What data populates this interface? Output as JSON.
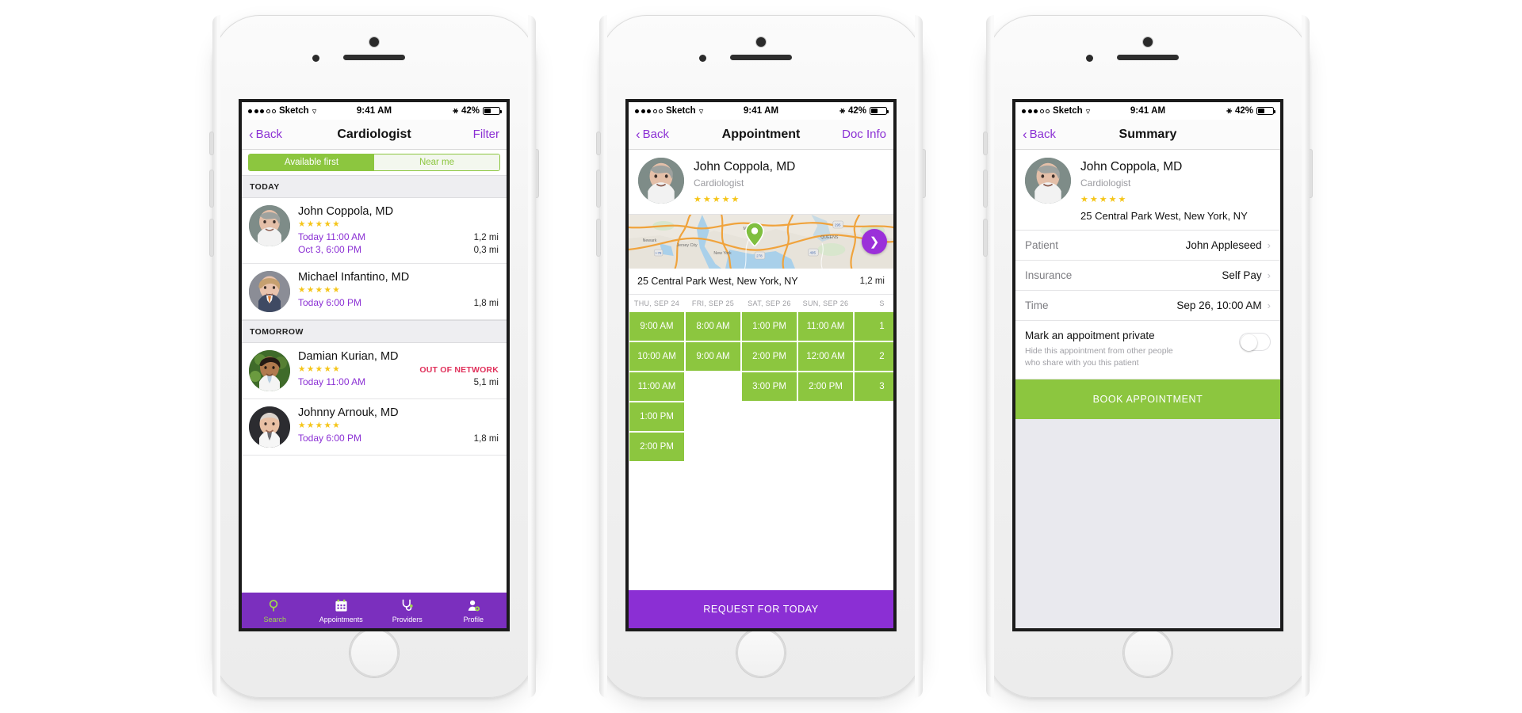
{
  "statusbar": {
    "carrier": "Sketch",
    "time": "9:41 AM",
    "battery": "42%",
    "wifi_icon": "wifi-icon",
    "bluetooth_icon": "bluetooth-icon"
  },
  "phone1": {
    "nav": {
      "back": "Back",
      "title": "Cardiologist",
      "right": "Filter"
    },
    "segmented": {
      "options": [
        "Available first",
        "Near me"
      ],
      "selected": "Available first"
    },
    "sections": [
      {
        "header": "TODAY",
        "doctors": [
          {
            "name": "John Coppola, MD",
            "stars": 5,
            "slots": [
              "Today 11:00 AM",
              "Oct 3, 6:00 PM"
            ],
            "distances": [
              "1,2 mi",
              "0,3 mi"
            ],
            "badge": ""
          },
          {
            "name": "Michael Infantino, MD",
            "stars": 5,
            "slots": [
              "Today 6:00 PM"
            ],
            "distances": [
              "1,8 mi"
            ],
            "badge": ""
          }
        ]
      },
      {
        "header": "TOMORROW",
        "doctors": [
          {
            "name": "Damian Kurian, MD",
            "stars": 5,
            "slots": [
              "Today 11:00 AM"
            ],
            "distances": [
              "5,1 mi"
            ],
            "badge": "OUT OF NETWORK"
          },
          {
            "name": "Johnny Arnouk, MD",
            "stars": 5,
            "slots": [
              "Today 6:00 PM"
            ],
            "distances": [
              "1,8 mi"
            ],
            "badge": ""
          }
        ]
      }
    ],
    "tabs": [
      {
        "label": "Search",
        "icon": "search-icon",
        "active": true
      },
      {
        "label": "Appointments",
        "icon": "calendar-icon",
        "active": false
      },
      {
        "label": "Providers",
        "icon": "stethoscope-icon",
        "active": false
      },
      {
        "label": "Profile",
        "icon": "profile-gear-icon",
        "active": false
      }
    ]
  },
  "phone2": {
    "nav": {
      "back": "Back",
      "title": "Appointment",
      "right": "Doc Info"
    },
    "doctor": {
      "name": "John Coppola, MD",
      "specialty": "Cardiologist",
      "stars": 5
    },
    "map": {
      "pin_icon": "map-pin-icon",
      "fab_icon": "chevron-right-icon",
      "labels": [
        "Newark",
        "Jersey City",
        "New York",
        "MIDTOWN",
        "QUEENS"
      ]
    },
    "address": {
      "text": "25 Central Park West, New York, NY",
      "distance": "1,2 mi"
    },
    "days": [
      "THU, SEP 24",
      "FRI, SEP 25",
      "SAT, SEP 26",
      "SUN, SEP 26",
      "S"
    ],
    "slot_rows": [
      [
        "9:00 AM",
        "8:00 AM",
        "1:00 PM",
        "11:00 AM",
        "1"
      ],
      [
        "10:00 AM",
        "9:00 AM",
        "2:00 PM",
        "12:00 AM",
        "2"
      ],
      [
        "11:00 AM",
        "",
        "3:00 PM",
        "2:00 PM",
        "3"
      ],
      [
        "1:00 PM",
        "",
        "",
        "",
        ""
      ],
      [
        "2:00 PM",
        "",
        "",
        "",
        ""
      ]
    ],
    "cta": "REQUEST FOR TODAY"
  },
  "phone3": {
    "nav": {
      "back": "Back",
      "title": "Summary"
    },
    "doctor": {
      "name": "John Coppola, MD",
      "specialty": "Cardiologist",
      "stars": 5,
      "address": "25 Central Park West, New York, NY"
    },
    "fields": [
      {
        "key": "Patient",
        "value": "John Appleseed"
      },
      {
        "key": "Insurance",
        "value": "Self Pay"
      },
      {
        "key": "Time",
        "value": "Sep 26, 10:00 AM"
      }
    ],
    "private": {
      "title": "Mark an appoitment private",
      "subtitle": "Hide this appointment from other people who share with you this patient",
      "toggle_on": false
    },
    "book_button": "BOOK APPOINTMENT"
  },
  "colors": {
    "purple": "#8b30d4",
    "tabbar_purple": "#7b2fbe",
    "green": "#8cc63f",
    "star_yellow": "#f5c518",
    "out_of_network_red": "#e0315b"
  }
}
